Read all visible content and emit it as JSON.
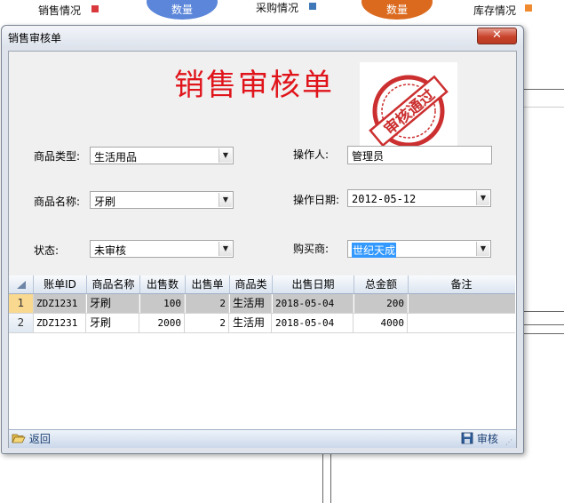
{
  "background": {
    "legend": [
      {
        "label": "销售情况",
        "color": "#d9393c"
      },
      {
        "label": "采购情况",
        "color": "#3e78b8"
      },
      {
        "label": "库存情况",
        "color": "#ef8a2e"
      }
    ],
    "bubbles": [
      {
        "label": "数量",
        "color": "#5b86d9"
      },
      {
        "label": "数量",
        "color": "#db6a1f"
      }
    ]
  },
  "window": {
    "title": "销售审核单",
    "close_symbol": "✕"
  },
  "form": {
    "heading": "销售审核单",
    "stamp_text": "审核通过",
    "stamp_color": "#cc2f2f",
    "product_type_label": "商品类型:",
    "product_type_value": "生活用品",
    "operator_label": "操作人:",
    "operator_value": "管理员",
    "product_name_label": "商品名称:",
    "product_name_value": "牙刷",
    "op_date_label": "操作日期:",
    "op_date_value": "2012-05-12",
    "status_label": "状态:",
    "status_value": "未审核",
    "buyer_label": "购买商:",
    "buyer_value": "世纪天成"
  },
  "grid": {
    "columns": [
      "账单ID",
      "商品名称",
      "出售数",
      "出售单",
      "商品类",
      "出售日期",
      "总金额",
      "备注"
    ],
    "rows": [
      {
        "num": "1",
        "id": "ZDZ1231",
        "name": "牙刷",
        "qty": "100",
        "unit": "2",
        "cat": "生活用",
        "date": "2018-05-04",
        "total": "200",
        "note": ""
      },
      {
        "num": "2",
        "id": "ZDZ1231",
        "name": "牙刷",
        "qty": "2000",
        "unit": "2",
        "cat": "生活用",
        "date": "2018-05-04",
        "total": "4000",
        "note": ""
      }
    ]
  },
  "toolbar": {
    "back_label": "返回",
    "approve_label": "审核"
  }
}
